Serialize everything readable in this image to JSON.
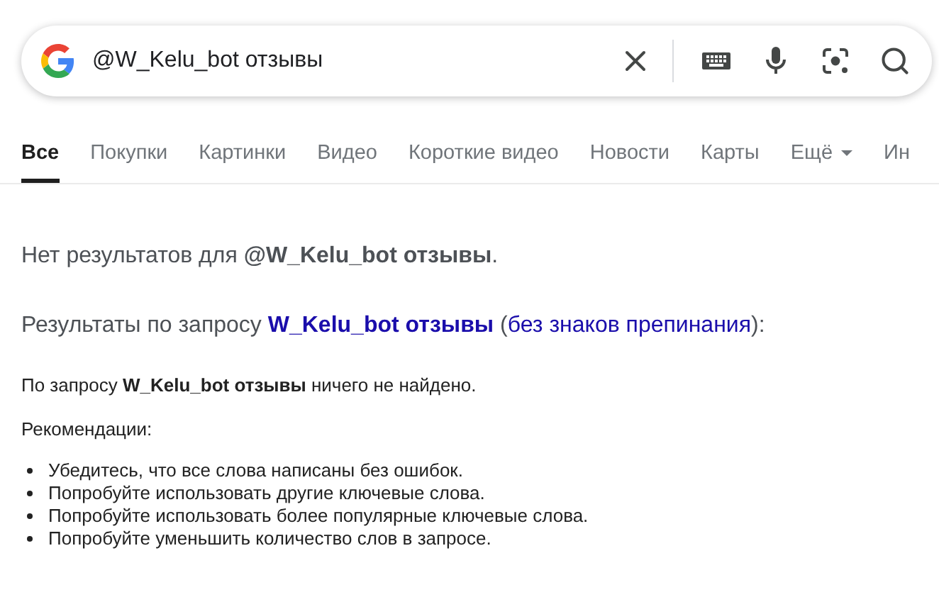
{
  "search": {
    "value": "@W_Kelu_bot отзывы"
  },
  "tabs": [
    {
      "label": "Все",
      "selected": true
    },
    {
      "label": "Покупки",
      "selected": false
    },
    {
      "label": "Картинки",
      "selected": false
    },
    {
      "label": "Видео",
      "selected": false
    },
    {
      "label": "Короткие видео",
      "selected": false
    },
    {
      "label": "Новости",
      "selected": false
    },
    {
      "label": "Карты",
      "selected": false
    },
    {
      "label": "Ещё",
      "selected": false,
      "kind": "menu"
    },
    {
      "label": "Ин",
      "selected": false
    }
  ],
  "no_results": "Нет результатов для **@W_Kelu_bot отзывы**.",
  "alt_query": {
    "prefix": "Результаты по запросу",
    "link": "W_Kelu_bot отзывы",
    "open": "(",
    "link2": "без знаков препинания",
    "close": "):"
  },
  "not_found": "По запросу **W_Kelu_bot отзывы** ничего не найдено.",
  "recommendations_title": "Рекомендации:",
  "recommendations": [
    "Убедитесь, что все слова написаны без ошибок.",
    "Попробуйте использовать другие ключевые слова.",
    "Попробуйте использовать более популярные ключевые слова.",
    "Попробуйте уменьшить количество слов в запросе."
  ]
}
